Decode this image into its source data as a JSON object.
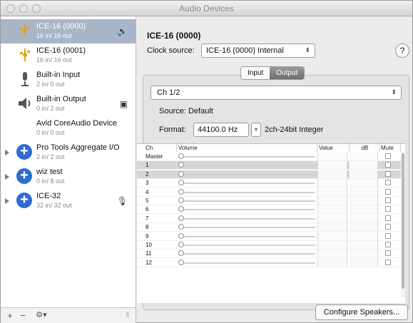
{
  "window": {
    "title": "Audio Devices"
  },
  "devices": [
    {
      "name": "ICE-16 (0000)",
      "io": "16 in/ 16 out",
      "icon": "usb-icon",
      "selected": true,
      "side_icon": "speaker-icon",
      "side_glyph": "🔊"
    },
    {
      "name": "ICE-16 (0001)",
      "io": "16 in/ 16 out",
      "icon": "usb-icon"
    },
    {
      "name": "Built-in Input",
      "io": "2 in/ 0 out",
      "icon": "microphone-icon"
    },
    {
      "name": "Built-in Output",
      "io": "0 in/ 2 out",
      "icon": "speaker-device-icon",
      "side_icon": "finder-icon",
      "side_glyph": "▣"
    },
    {
      "name": "Avid CoreAudio Device",
      "io": "0 in/ 0 out",
      "icon": ""
    },
    {
      "name": "Pro Tools Aggregate I/O",
      "io": "2 in/ 2 out",
      "icon": "aggregate-plus-icon",
      "disclosure": true
    },
    {
      "name": "wiz test",
      "io": "0 in/ 8 out",
      "icon": "aggregate-plus-icon",
      "disclosure": true
    },
    {
      "name": "ICE-32",
      "io": "32 in/ 32 out",
      "icon": "aggregate-plus-icon",
      "disclosure": true,
      "side_icon": "microphone-icon",
      "side_glyph": "🎙"
    }
  ],
  "footer": {
    "add": "+",
    "remove": "−",
    "gear": "⚙▾",
    "grip": "⦀"
  },
  "detail": {
    "device_title": "ICE-16 (0000)",
    "clock_label": "Clock source:",
    "clock_value": "ICE-16 (0000) Internal",
    "help": "?",
    "tabs": [
      "Input",
      "Output"
    ],
    "active_tab": "Output",
    "channel_select": "Ch 1/2",
    "source": "Source: Default",
    "format_label": "Format:",
    "format_value": "44100.0 Hz",
    "format_desc": "2ch-24bit Integer",
    "table": {
      "headers": {
        "ch": "Ch",
        "volume": "Volume",
        "value": "Value",
        "db": "dB",
        "mute": "Mute"
      },
      "rows": [
        {
          "ch": "Master",
          "highlight": false
        },
        {
          "ch": "1",
          "highlight": true
        },
        {
          "ch": "2",
          "highlight": true
        },
        {
          "ch": "3",
          "highlight": false
        },
        {
          "ch": "4",
          "highlight": false
        },
        {
          "ch": "5",
          "highlight": false
        },
        {
          "ch": "6",
          "highlight": false
        },
        {
          "ch": "7",
          "highlight": false
        },
        {
          "ch": "8",
          "highlight": false
        },
        {
          "ch": "9",
          "highlight": false
        },
        {
          "ch": "10",
          "highlight": false
        },
        {
          "ch": "11",
          "highlight": false
        },
        {
          "ch": "12",
          "highlight": false
        }
      ]
    },
    "configure_button": "Configure Speakers..."
  }
}
